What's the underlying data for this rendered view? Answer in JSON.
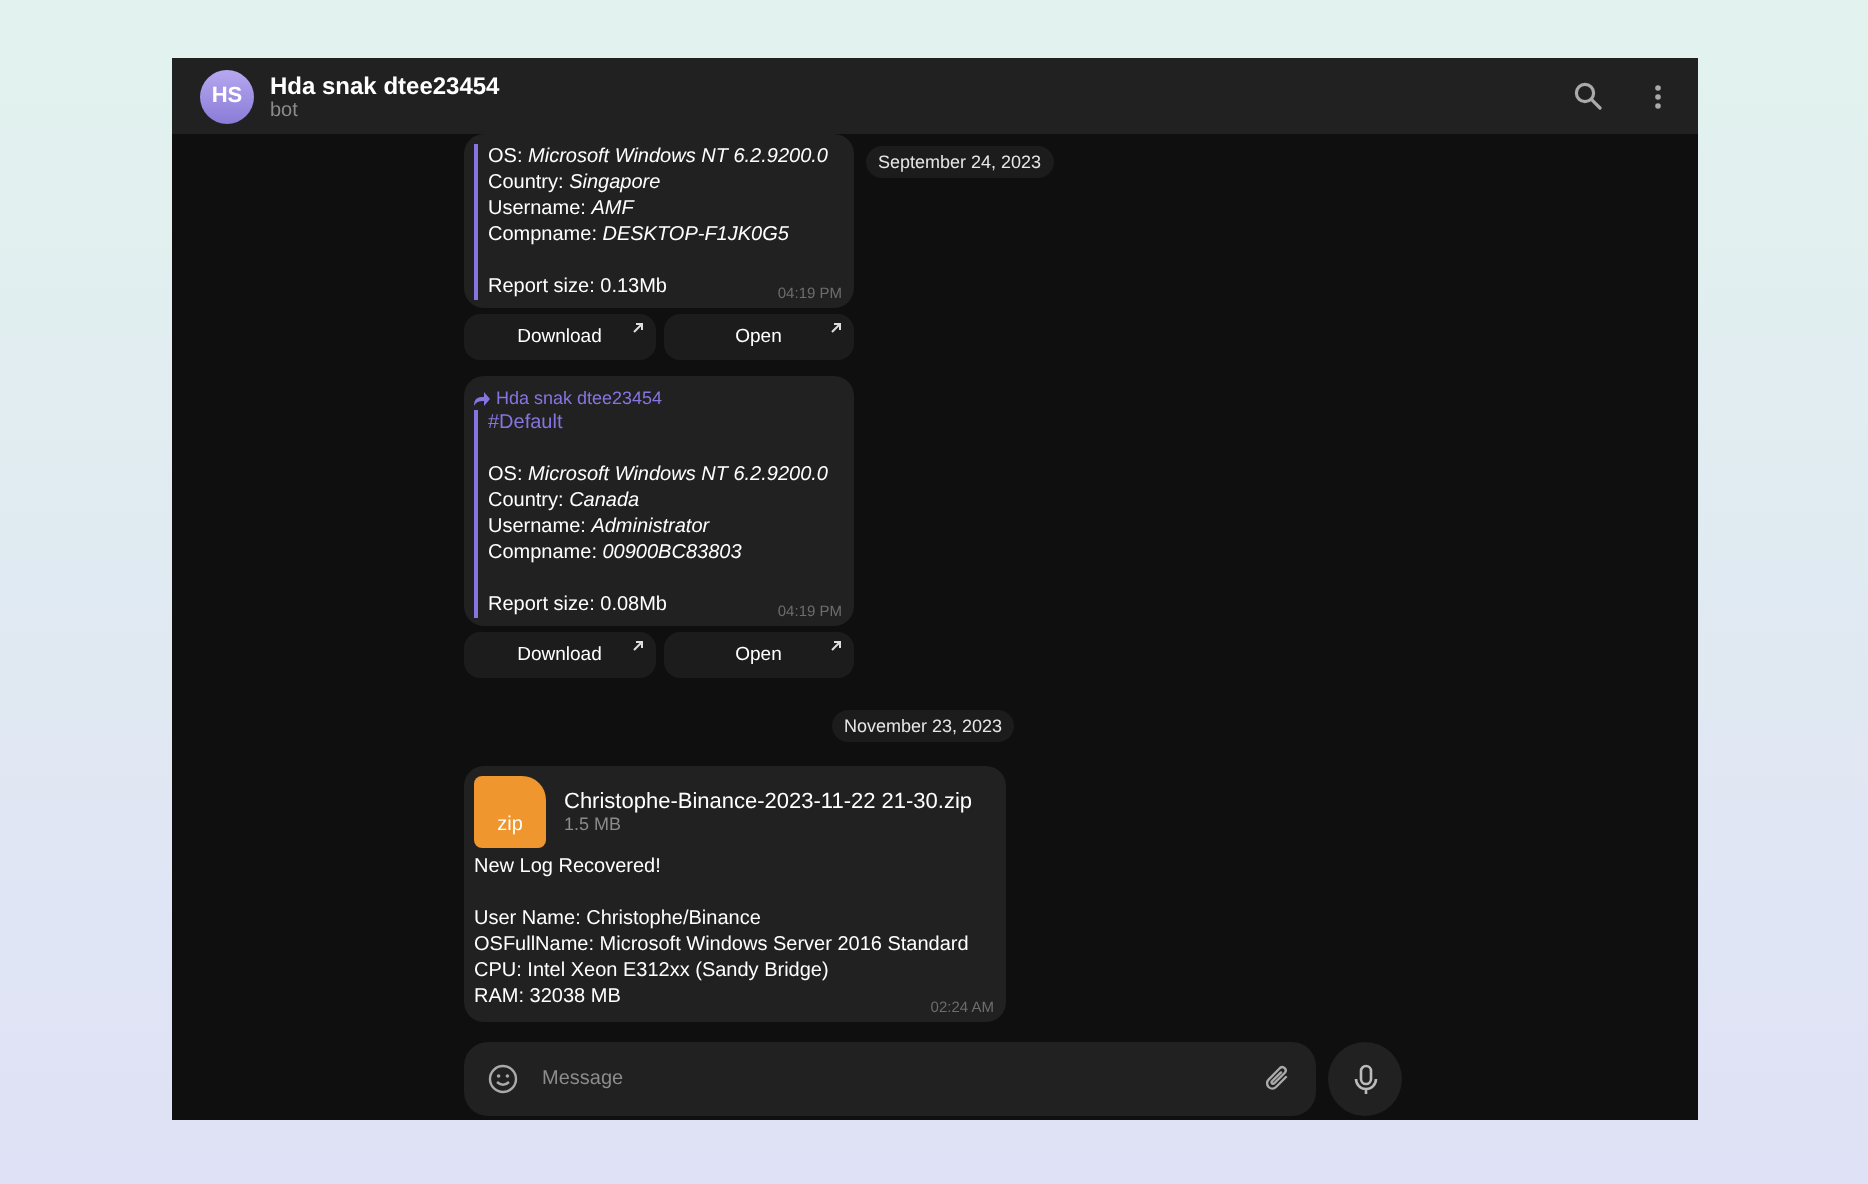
{
  "header": {
    "avatar_initials": "HS",
    "title": "Hda snak dtee23454",
    "subtitle": "bot"
  },
  "sticky_date": "September 24, 2023",
  "feed": [
    {
      "kind": "report",
      "fields": [
        {
          "label": "OS:",
          "value": "Microsoft Windows NT 6.2.9200.0"
        },
        {
          "label": "Country:",
          "value": "Singapore"
        },
        {
          "label": "Username:",
          "value": "AMF"
        },
        {
          "label": "Compname:",
          "value": "DESKTOP-F1JK0G5"
        }
      ],
      "report_size": "Report size: 0.13Mb",
      "time": "04:19 PM",
      "buttons": [
        "Download",
        "Open"
      ]
    },
    {
      "kind": "report",
      "forwarded_from": "Hda snak dtee23454",
      "tag": "#Default",
      "fields": [
        {
          "label": "OS:",
          "value": "Microsoft Windows NT 6.2.9200.0"
        },
        {
          "label": "Country:",
          "value": "Canada"
        },
        {
          "label": "Username:",
          "value": "Administrator"
        },
        {
          "label": "Compname:",
          "value": "00900BC83803"
        }
      ],
      "report_size": "Report size: 0.08Mb",
      "time": "04:19 PM",
      "buttons": [
        "Download",
        "Open"
      ]
    },
    {
      "kind": "date",
      "text": "November 23, 2023"
    },
    {
      "kind": "file",
      "file_ext": "zip",
      "file_name": "Christophe-Binance-2023-11-22 21-30.zip",
      "file_size": "1.5 MB",
      "intro": "New Log Recovered!",
      "lines": [
        "User Name: Christophe/Binance",
        "OSFullName: Microsoft Windows Server 2016 Standard",
        "CPU: Intel Xeon E312xx (Sandy Bridge)",
        "RAM: 32038 MB"
      ],
      "time": "02:24 AM"
    }
  ],
  "composer": {
    "placeholder": "Message"
  }
}
